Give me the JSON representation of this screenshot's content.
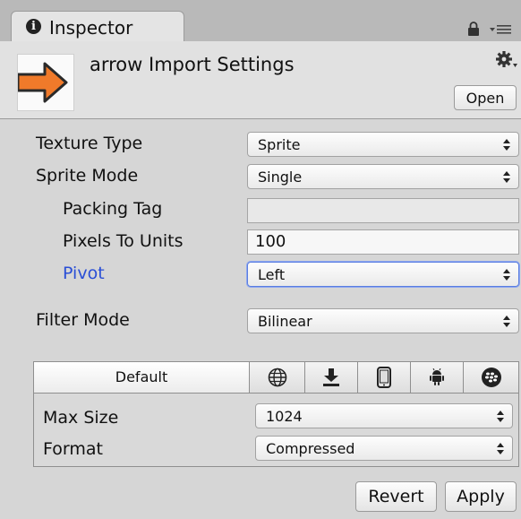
{
  "tab": {
    "label": "Inspector",
    "info_icon": "info-icon",
    "lock_icon": "lock-icon",
    "menu_icon": "menu-icon"
  },
  "header": {
    "title": "arrow Import Settings",
    "thumbnail_icon": "arrow-icon",
    "gear_icon": "gear-icon",
    "open_label": "Open",
    "arrow_color": "#f07a2a"
  },
  "fields": {
    "texture_type": {
      "label": "Texture Type",
      "value": "Sprite"
    },
    "sprite_mode": {
      "label": "Sprite Mode",
      "value": "Single"
    },
    "packing_tag": {
      "label": "Packing Tag",
      "value": ""
    },
    "pixels_to_units": {
      "label": "Pixels To Units",
      "value": "100"
    },
    "pivot": {
      "label": "Pivot",
      "value": "Left",
      "label_color": "#2a4fd6"
    },
    "filter_mode": {
      "label": "Filter Mode",
      "value": "Bilinear"
    }
  },
  "platform": {
    "tabs": [
      {
        "label": "Default",
        "selected": true
      },
      {
        "icon": "globe-icon"
      },
      {
        "icon": "download-icon"
      },
      {
        "icon": "phone-icon"
      },
      {
        "icon": "android-icon"
      },
      {
        "icon": "blackberry-icon"
      }
    ],
    "max_size": {
      "label": "Max Size",
      "value": "1024"
    },
    "format": {
      "label": "Format",
      "value": "Compressed"
    }
  },
  "footer": {
    "revert_label": "Revert",
    "apply_label": "Apply"
  }
}
